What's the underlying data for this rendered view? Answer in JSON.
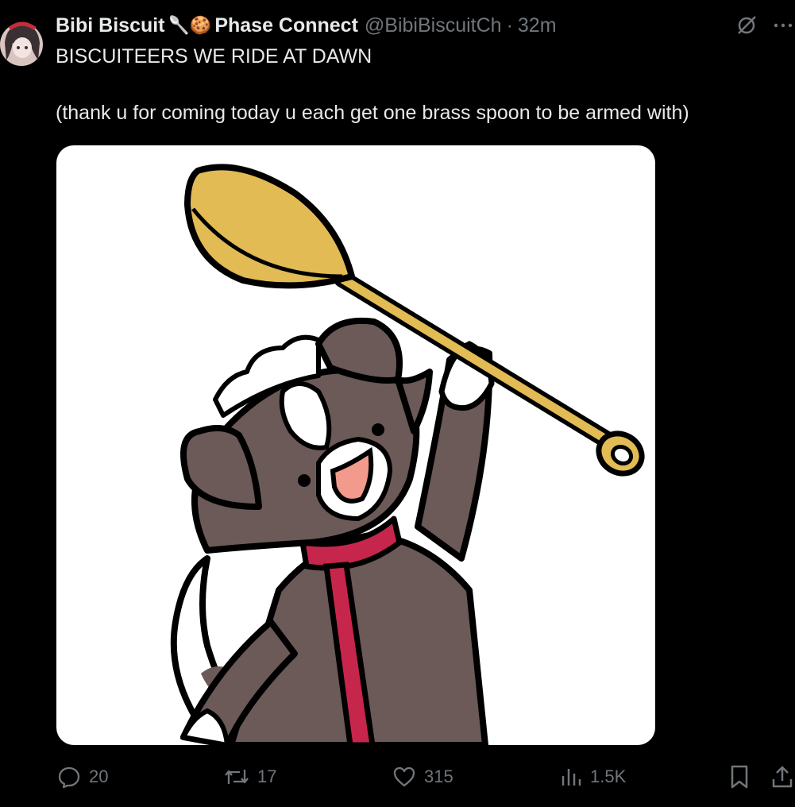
{
  "post": {
    "author_name": "Bibi Biscuit",
    "author_badges": "🥄🍪",
    "org_name": "Phase Connect",
    "handle": "@BibiBiscuitCh",
    "separator": "·",
    "time": "32m",
    "text_line1": "BISCUITEERS WE RIDE AT DAWN",
    "text_line2": "(thank u for coming today u each get one brass spoon to be armed with)"
  },
  "icons": {
    "grok": "slashed-circle-icon",
    "more": "more-dots-icon",
    "reply": "reply-icon",
    "repost": "repost-icon",
    "like": "heart-icon",
    "views": "bar-chart-icon",
    "bookmark": "bookmark-icon",
    "share": "share-icon"
  },
  "stats": {
    "replies": "20",
    "reposts": "17",
    "likes": "315",
    "views": "1.5K"
  },
  "colors": {
    "background": "#000000",
    "text": "#e7e9ea",
    "muted": "#71767b",
    "spoon": "#e2bb55",
    "fur": "#6b5a58",
    "collar": "#c7264c"
  }
}
